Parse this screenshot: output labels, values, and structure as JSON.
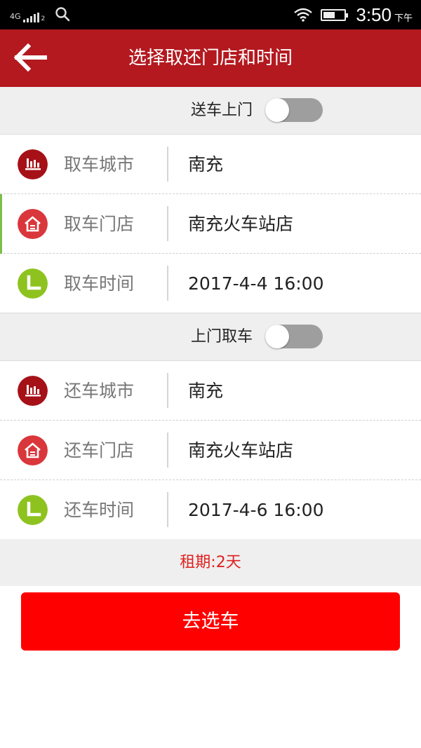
{
  "status_bar": {
    "network": "4G",
    "sim": "2",
    "time": "3:50",
    "ampm": "下午",
    "battery_level": 0.55,
    "icons": [
      "signal-icon",
      "search-icon",
      "wifi-icon",
      "battery-icon"
    ]
  },
  "header": {
    "title": "选择取还门店和时间",
    "back_icon": "back-arrow-icon",
    "color": "#b3191f"
  },
  "pickup": {
    "delivery_toggle_label": "送车上门",
    "delivery_toggle_on": false,
    "rows": [
      {
        "label": "取车城市",
        "value": "南充",
        "icon": "city-icon",
        "icon_color": "#a51117"
      },
      {
        "label": "取车门店",
        "value": "南充火车站店",
        "icon": "store-icon",
        "icon_color": "#d9373b"
      },
      {
        "label": "取车时间",
        "value": "2017-4-4 16:00",
        "icon": "clock-icon",
        "icon_color": "#8ec31f"
      }
    ]
  },
  "return": {
    "collect_toggle_label": "上门取车",
    "collect_toggle_on": false,
    "rows": [
      {
        "label": "还车城市",
        "value": "南充",
        "icon": "city-icon",
        "icon_color": "#a51117"
      },
      {
        "label": "还车门店",
        "value": "南充火车站店",
        "icon": "store-icon",
        "icon_color": "#d9373b"
      },
      {
        "label": "还车时间",
        "value": "2017-4-6 16:00",
        "icon": "clock-icon",
        "icon_color": "#8ec31f"
      }
    ]
  },
  "rental_period": "租期:2天",
  "cta_label": "去选车",
  "colors": {
    "accent_red": "#ff0000",
    "period_text": "#e02020",
    "toggle_off": "#9e9e9e"
  }
}
